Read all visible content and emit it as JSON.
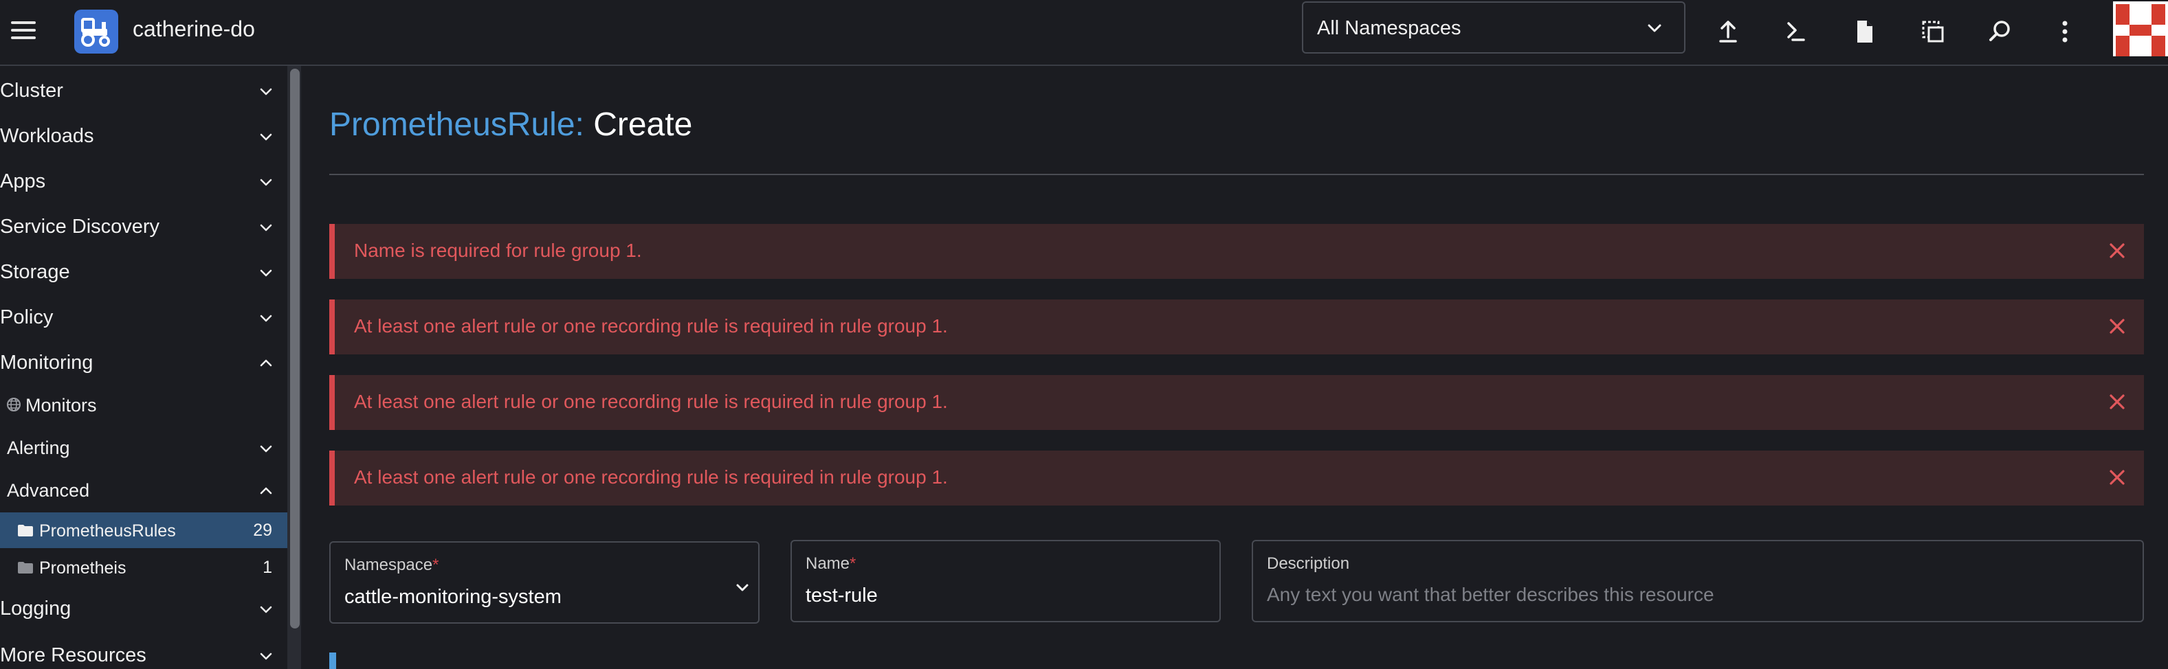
{
  "header": {
    "cluster_name": "catherine-do",
    "namespace_select": {
      "value": "All Namespaces"
    },
    "icons": [
      "upload-icon",
      "kubectl-shell-icon",
      "file-icon",
      "copy-config-icon",
      "search-icon",
      "more-vert-icon"
    ]
  },
  "sidebar": {
    "items": [
      {
        "label": "Cluster",
        "state": "collapsed"
      },
      {
        "label": "Workloads",
        "state": "collapsed"
      },
      {
        "label": "Apps",
        "state": "collapsed"
      },
      {
        "label": "Service Discovery",
        "state": "collapsed"
      },
      {
        "label": "Storage",
        "state": "collapsed"
      },
      {
        "label": "Policy",
        "state": "collapsed"
      },
      {
        "label": "Monitoring",
        "state": "expanded"
      },
      {
        "label": "Monitors",
        "icon": "globe-icon"
      },
      {
        "label": "Alerting",
        "state": "collapsed"
      },
      {
        "label": "Advanced",
        "state": "expanded"
      },
      {
        "label": "PrometheusRules",
        "count": "29",
        "icon": "folder-icon",
        "active": true
      },
      {
        "label": "Prometheis",
        "count": "1",
        "icon": "folder-icon"
      },
      {
        "label": "Logging",
        "state": "collapsed"
      },
      {
        "label": "More Resources",
        "state": "collapsed"
      }
    ]
  },
  "main": {
    "title_type": "PrometheusRule:",
    "title_action": "Create",
    "errors": [
      "Name is required for rule group 1.",
      "At least one alert rule or one recording rule is required in rule group 1.",
      "At least one alert rule or one recording rule is required in rule group 1.",
      "At least one alert rule or one recording rule is required in rule group 1."
    ],
    "namespace": {
      "label": "Namespace",
      "required_mark": "*",
      "value": "cattle-monitoring-system"
    },
    "name": {
      "label": "Name",
      "required_mark": "*",
      "value": "test-rule"
    },
    "description": {
      "label": "Description",
      "placeholder": "Any text you want that better describes this resource"
    }
  },
  "colors": {
    "background": "#1b1c21",
    "accent_blue": "#4f9ddd",
    "error_red": "#d4464b",
    "error_bg": "#3b2629",
    "active_nav": "#2d4f73"
  }
}
